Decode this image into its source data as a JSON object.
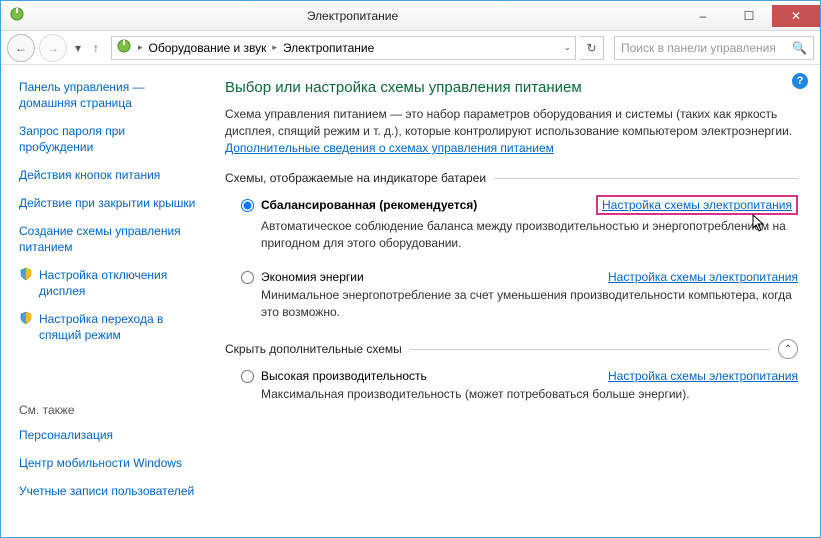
{
  "window": {
    "title": "Электропитание",
    "min": "–",
    "max": "☐",
    "close": "✕"
  },
  "toolbar": {
    "breadcrumb1": "Оборудование и звук",
    "breadcrumb2": "Электропитание",
    "search_placeholder": "Поиск в панели управления"
  },
  "sidebar": {
    "home": "Панель управления — домашняя страница",
    "items": [
      "Запрос пароля при пробуждении",
      "Действия кнопок питания",
      "Действие при закрытии крышки",
      "Создание схемы управления питанием"
    ],
    "icon_items": [
      "Настройка отключения дисплея",
      "Настройка перехода в спящий режим"
    ],
    "see_also_label": "См. также",
    "see_also": [
      "Персонализация",
      "Центр мобильности Windows",
      "Учетные записи пользователей"
    ]
  },
  "main": {
    "heading": "Выбор или настройка схемы управления питанием",
    "description": "Схема управления питанием — это набор параметров оборудования и системы (таких как яркость дисплея, спящий режим и т. д.), которые контролируют использование компьютером электроэнергии. ",
    "description_link": "Дополнительные сведения о схемах управления питанием",
    "section1_label": "Схемы, отображаемые на индикаторе батареи",
    "section2_label": "Скрыть дополнительные схемы",
    "plans": [
      {
        "name": "Сбалансированная (рекомендуется)",
        "link": "Настройка схемы электропитания",
        "desc": "Автоматическое соблюдение баланса между производительностью и энергопотреблением на пригодном для этого оборудовании."
      },
      {
        "name": "Экономия энергии",
        "link": "Настройка схемы электропитания",
        "desc": "Минимальное энергопотребление за счет уменьшения производительности компьютера, когда это возможно."
      },
      {
        "name": "Высокая производительность",
        "link": "Настройка схемы электропитания",
        "desc": "Максимальная производительность (может потребоваться больше энергии)."
      }
    ]
  }
}
